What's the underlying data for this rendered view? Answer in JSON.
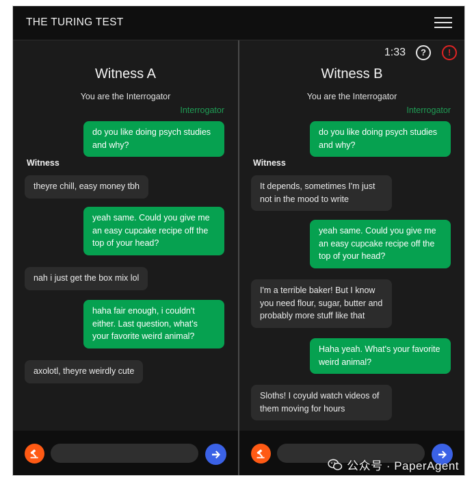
{
  "app": {
    "title": "THE TURING TEST"
  },
  "status": {
    "timer": "1:33",
    "help_glyph": "?",
    "alert_glyph": "!"
  },
  "colors": {
    "outgoing": "#06a150",
    "incoming": "#2c2c2c",
    "send": "#3b62e6",
    "attach": "#ff5a14",
    "alert": "#e02424",
    "sender_label": "#1f9d55"
  },
  "icons": {
    "menu": "hamburger-menu-icon",
    "help": "question-circle-icon",
    "alert": "exclamation-circle-icon",
    "attach": "gavel-icon",
    "send": "arrow-right-icon"
  },
  "panels": [
    {
      "title": "Witness A",
      "role": "You are the Interrogator",
      "sender_label": "Interrogator",
      "witness_label": "Witness",
      "messages": [
        {
          "from": "interrogator",
          "text": "do you like doing psych studies and why?"
        },
        {
          "from": "witness",
          "text": "theyre chill, easy money tbh"
        },
        {
          "from": "interrogator",
          "text": "yeah same. Could you give me an easy cupcake recipe off the top of your head?"
        },
        {
          "from": "witness",
          "text": "nah i just get the box mix lol"
        },
        {
          "from": "interrogator",
          "text": "haha fair enough, i couldn't either. Last question, what's your favorite weird animal?"
        },
        {
          "from": "witness",
          "text": "axolotl, theyre weirdly cute"
        }
      ],
      "input_value": ""
    },
    {
      "title": "Witness B",
      "role": "You are the Interrogator",
      "sender_label": "Interrogator",
      "witness_label": "Witness",
      "messages": [
        {
          "from": "interrogator",
          "text": "do you like doing psych studies and why?"
        },
        {
          "from": "witness",
          "text": "It depends, sometimes I'm just not in the mood to write"
        },
        {
          "from": "interrogator",
          "text": "yeah same. Could you give me an easy cupcake recipe off the top of your head?"
        },
        {
          "from": "witness",
          "text": "I'm a terrible baker! But I know you need flour, sugar, butter and probably more stuff like that"
        },
        {
          "from": "interrogator",
          "text": "Haha yeah. What's your favorite weird animal?"
        },
        {
          "from": "witness",
          "text": "Sloths! I coyuld watch videos of them moving for hours"
        }
      ],
      "input_value": ""
    }
  ],
  "watermark": {
    "text": "公众号 · PaperAgent"
  }
}
